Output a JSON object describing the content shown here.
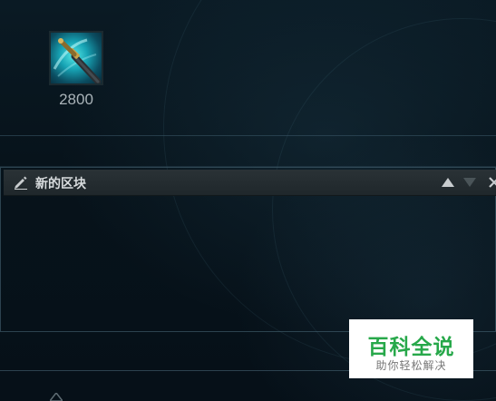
{
  "item": {
    "price": "2800",
    "icon": "sword-item-icon"
  },
  "block": {
    "title": "新的区块",
    "icons": {
      "edit": "pencil-icon",
      "move_up": "triangle-up-icon",
      "move_down": "triangle-down-icon",
      "close": "close-icon"
    }
  },
  "watermark": {
    "brand": "百科全说",
    "slogan": "助你轻松解决"
  },
  "colors": {
    "background": "#071018",
    "header": "#242c30",
    "brand_green": "#27a84a"
  }
}
